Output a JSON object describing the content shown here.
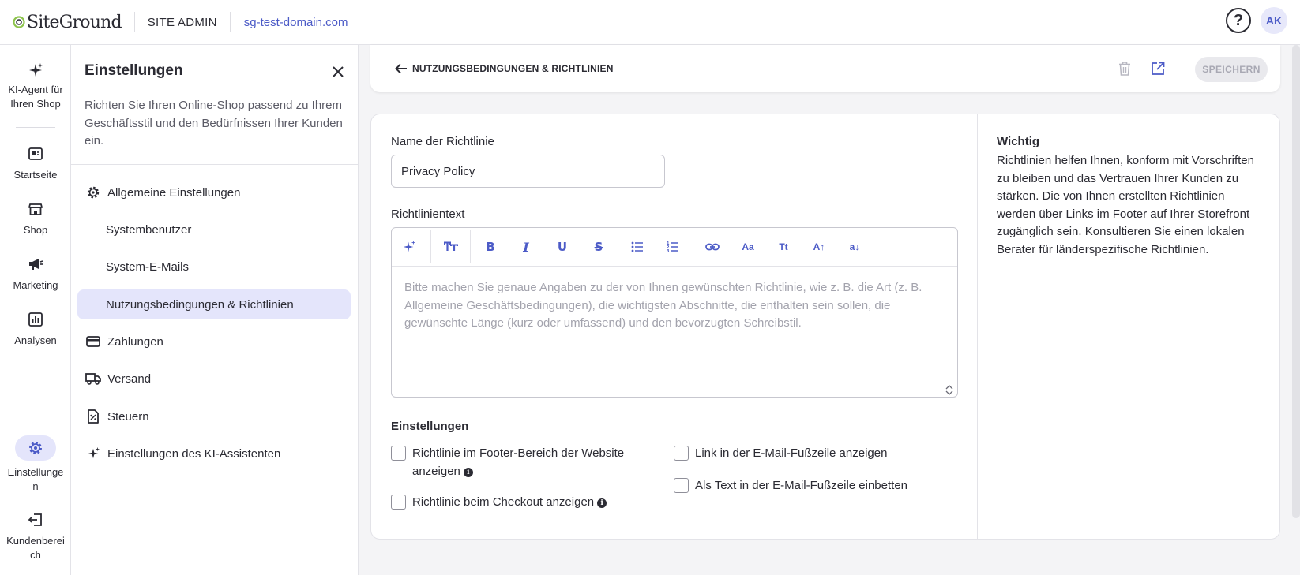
{
  "topbar": {
    "logo_text": "SiteGround",
    "site_admin": "SITE ADMIN",
    "domain": "sg-test-domain.com",
    "help_icon": "question-circle-icon",
    "avatar_initials": "AK"
  },
  "rail": {
    "items": [
      {
        "label": "KI-Agent für Ihren Shop",
        "icon": "sparkle-icon"
      },
      {
        "label": "Startseite",
        "icon": "home-dashboard-icon"
      },
      {
        "label": "Shop",
        "icon": "store-icon"
      },
      {
        "label": "Marketing",
        "icon": "megaphone-icon"
      },
      {
        "label": "Analysen",
        "icon": "chart-icon"
      },
      {
        "label": "Einstellungen",
        "icon": "gear-icon"
      },
      {
        "label": "Kundenbereich",
        "icon": "exit-icon"
      }
    ]
  },
  "panel": {
    "title": "Einstellungen",
    "description": "Richten Sie Ihren Online-Shop passend zu Ihrem Geschäftsstil und den Bedürfnissen Ihrer Kunden ein.",
    "nav": [
      {
        "label": "Allgemeine Einstellungen",
        "icon": "gear-icon"
      },
      {
        "label": "Systembenutzer"
      },
      {
        "label": "System-E-Mails"
      },
      {
        "label": "Nutzungsbedingungen & Richtlinien",
        "active": true
      },
      {
        "label": "Zahlungen",
        "icon": "card-icon"
      },
      {
        "label": "Versand",
        "icon": "truck-icon"
      },
      {
        "label": "Steuern",
        "icon": "tax-icon"
      },
      {
        "label": "Einstellungen des KI-Assistenten",
        "icon": "sparkle-icon"
      }
    ]
  },
  "header": {
    "title": "NUTZUNGSBEDINGUNGEN & RICHTLINIEN",
    "save_label": "SPEICHERN"
  },
  "form": {
    "name_label": "Name der Richtlinie",
    "name_value": "Privacy Policy",
    "text_label": "Richtlinientext",
    "editor_placeholder": "Bitte machen Sie genaue Angaben zu der von Ihnen gewünschten Richtlinie, wie z. B. die Art (z. B. Allgemeine Geschäftsbedingungen), die wichtigsten Abschnitte, die enthalten sein sollen, die gewünschte Länge (kurz oder umfassend) und den bevorzugten Schreibstil.",
    "toolbar": {
      "font_size_small": "Aa",
      "text_type": "Tt",
      "increase": "A",
      "decrease": "a"
    },
    "settings_title": "Einstellungen",
    "checkboxes": {
      "footer": "Richtlinie im Footer-Bereich der Website anzeigen",
      "checkout": "Richtlinie beim Checkout anzeigen",
      "email_link": "Link in der E-Mail-Fußzeile anzeigen",
      "email_embed": "Als Text in der E-Mail-Fußzeile einbetten"
    }
  },
  "info": {
    "title": "Wichtig",
    "text": "Richtlinien helfen Ihnen, konform mit Vorschriften zu bleiben und das Vertrauen Ihrer Kunden zu stärken. Die von Ihnen erstellten Richtlinien werden über Links im Footer auf Ihrer Storefront zugänglich sein. Konsultieren Sie einen lokalen Berater für länderspezifische Richtlinien."
  },
  "colors": {
    "accent": "#4c5bc7",
    "active_bg": "#e4e5fb",
    "logo_green": "#8bc34a"
  }
}
